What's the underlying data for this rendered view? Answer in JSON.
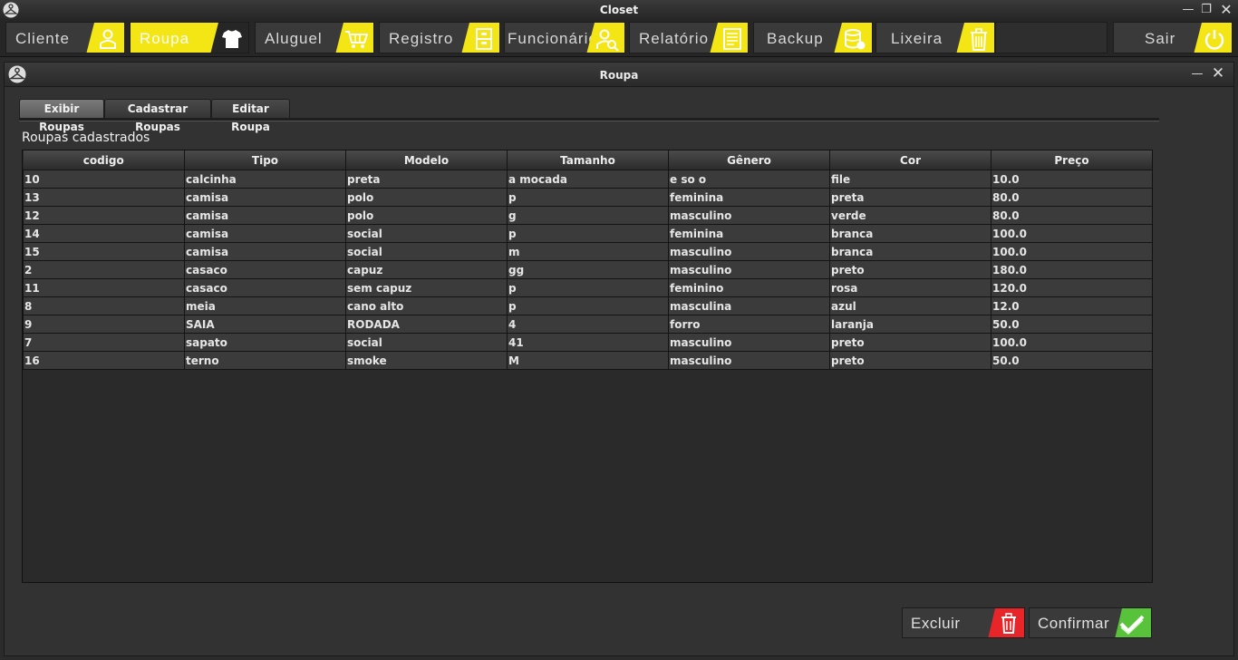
{
  "window": {
    "title": "Closet"
  },
  "nav": {
    "items": [
      {
        "label": "Cliente",
        "icon": "person-icon"
      },
      {
        "label": "Roupa",
        "icon": "shirt-icon"
      },
      {
        "label": "Aluguel",
        "icon": "cart-icon"
      },
      {
        "label": "Registro",
        "icon": "file-cabinet-icon"
      },
      {
        "label": "Funcionário",
        "icon": "employee-search-icon"
      },
      {
        "label": "Relatório",
        "icon": "report-icon"
      },
      {
        "label": "Backup",
        "icon": "database-icon"
      },
      {
        "label": "Lixeira",
        "icon": "trash-icon"
      },
      {
        "label": "Sair",
        "icon": "power-icon"
      }
    ],
    "active": "Roupa"
  },
  "frame": {
    "title": "Roupa",
    "tabs": [
      "Exibir Roupas",
      "Cadastrar Roupas",
      "Editar Roupa"
    ],
    "active_tab": "Exibir Roupas",
    "section_label": "Roupas cadastrados"
  },
  "table": {
    "columns": [
      "codigo",
      "Tipo",
      "Modelo",
      "Tamanho",
      "Gênero",
      "Cor",
      "Preço"
    ],
    "rows": [
      [
        "10",
        "calcinha",
        "preta",
        "a mocada",
        "e so o",
        "file",
        "10.0"
      ],
      [
        "13",
        "camisa",
        "polo",
        "p",
        "feminina",
        "preta",
        "80.0"
      ],
      [
        "12",
        "camisa",
        "polo",
        "g",
        "masculino",
        "verde",
        "80.0"
      ],
      [
        "14",
        "camisa",
        "social",
        "p",
        "feminina",
        "branca",
        "100.0"
      ],
      [
        "15",
        "camisa",
        "social",
        "m",
        "masculino",
        "branca",
        "100.0"
      ],
      [
        "2",
        "casaco",
        "capuz",
        "gg",
        "masculino",
        "preto",
        "180.0"
      ],
      [
        "11",
        "casaco",
        "sem capuz",
        "p",
        "feminino",
        "rosa",
        "120.0"
      ],
      [
        "8",
        "meia",
        "cano alto",
        "p",
        "masculina",
        "azul",
        "12.0"
      ],
      [
        "9",
        "SAIA",
        "RODADA",
        "4",
        "forro",
        "laranja",
        "50.0"
      ],
      [
        "7",
        "sapato",
        "social",
        "41",
        "masculino",
        "preto",
        "100.0"
      ],
      [
        "16",
        "terno",
        "smoke",
        "M",
        "masculino",
        "preto",
        "50.0"
      ]
    ]
  },
  "actions": {
    "delete_label": "Excluir",
    "confirm_label": "Confirmar"
  },
  "colors": {
    "accent_yellow": "#f3e614",
    "delete_red": "#e8262a",
    "confirm_green": "#58c23a",
    "background": "#2b2b2b"
  }
}
